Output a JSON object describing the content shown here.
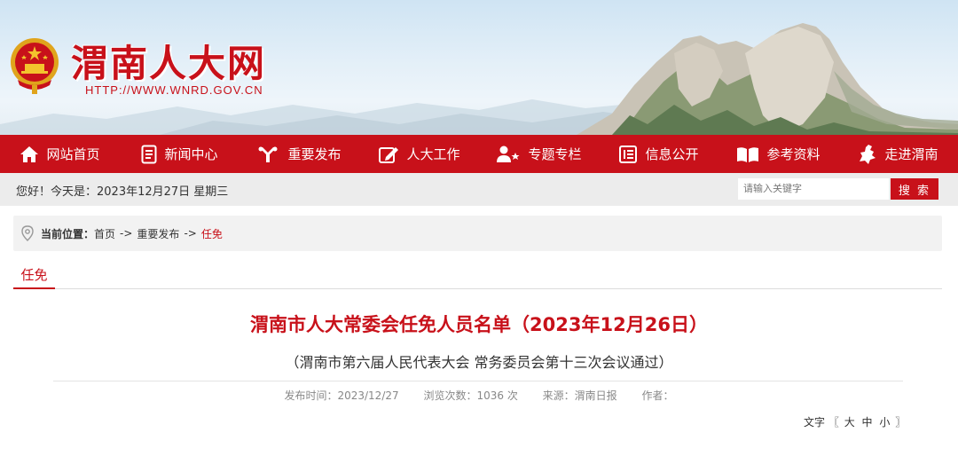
{
  "header": {
    "site_title": "渭南人大网",
    "site_url": "HTTP://WWW.WNRD.GOV.CN"
  },
  "nav": {
    "items": [
      {
        "label": "网站首页",
        "icon": "home-icon"
      },
      {
        "label": "新闻中心",
        "icon": "document-icon"
      },
      {
        "label": "重要发布",
        "icon": "megaphone-icon"
      },
      {
        "label": "人大工作",
        "icon": "edit-icon"
      },
      {
        "label": "专题专栏",
        "icon": "user-star-icon"
      },
      {
        "label": "信息公开",
        "icon": "notebook-icon"
      },
      {
        "label": "参考资料",
        "icon": "open-book-icon"
      },
      {
        "label": "走进渭南",
        "icon": "province-map-icon"
      }
    ]
  },
  "infobar": {
    "greeting": "您好！今天是：2023年12月27日 星期三",
    "search_placeholder": "请输入关键字",
    "search_button": "搜 索"
  },
  "breadcrumb": {
    "label": "当前位置：",
    "items": [
      "首页",
      "重要发布",
      "任免"
    ],
    "separator": "->"
  },
  "column_tab": "任免",
  "article": {
    "title": "渭南市人大常委会任免人员名单（2023年12月26日）",
    "subtitle": "（渭南市第六届人民代表大会 常务委员会第十三次会议通过）",
    "publish_time": "发布时间：2023/12/27",
    "views": "浏览次数：1036 次",
    "source": "来源：渭南日报",
    "author": "作者：",
    "font_size_label": "文字",
    "font_size_open": "〖",
    "font_size_options": [
      "大",
      "中",
      "小"
    ],
    "font_size_close": "〗"
  },
  "colors": {
    "brand_red": "#c8111a",
    "infobar_bg": "#ececec"
  }
}
